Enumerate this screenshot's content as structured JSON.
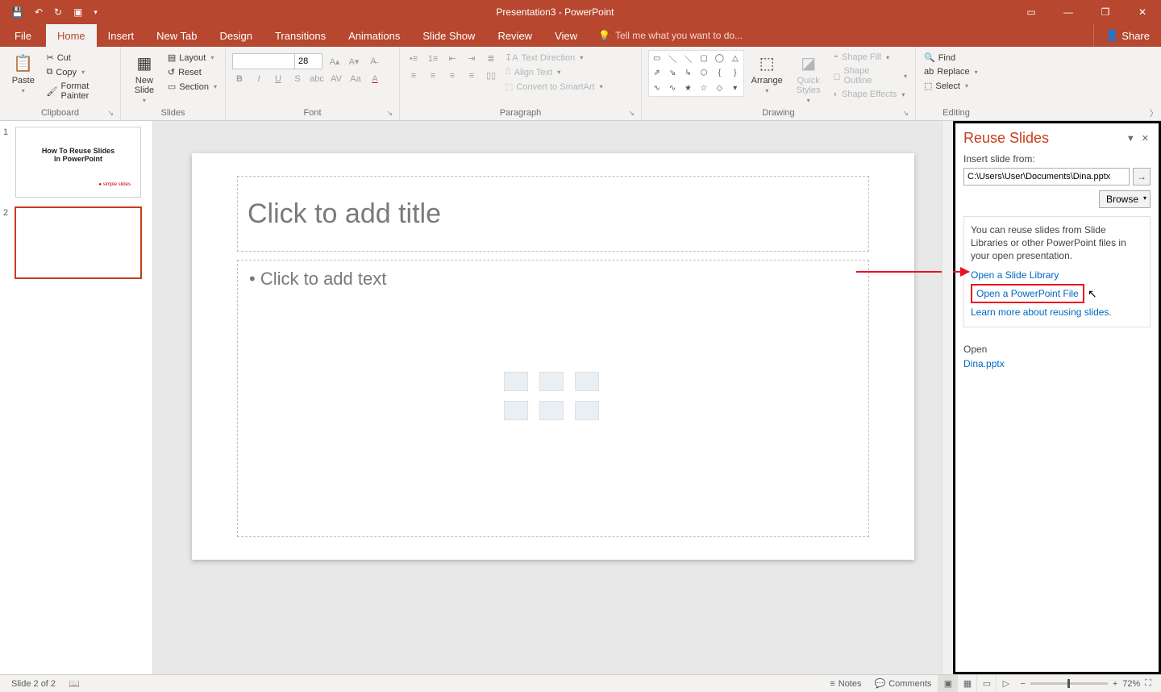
{
  "titlebar": {
    "title": "Presentation3 - PowerPoint"
  },
  "tabs": {
    "file": "File",
    "home": "Home",
    "insert": "Insert",
    "newtab": "New Tab",
    "design": "Design",
    "transitions": "Transitions",
    "animations": "Animations",
    "slideshow": "Slide Show",
    "review": "Review",
    "view": "View",
    "tellme": "Tell me what you want to do...",
    "share": "Share"
  },
  "ribbon": {
    "clipboard": {
      "label": "Clipboard",
      "paste": "Paste",
      "cut": "Cut",
      "copy": "Copy",
      "painter": "Format Painter"
    },
    "slides": {
      "label": "Slides",
      "new": "New\nSlide",
      "layout": "Layout",
      "reset": "Reset",
      "section": "Section"
    },
    "font": {
      "label": "Font",
      "size": "28"
    },
    "paragraph": {
      "label": "Paragraph",
      "textdir": "Text Direction",
      "align": "Align Text",
      "smartart": "Convert to SmartArt"
    },
    "drawing": {
      "label": "Drawing",
      "arrange": "Arrange",
      "quick": "Quick\nStyles",
      "fill": "Shape Fill",
      "outline": "Shape Outline",
      "effects": "Shape Effects"
    },
    "editing": {
      "label": "Editing",
      "find": "Find",
      "replace": "Replace",
      "select": "Select"
    }
  },
  "thumbs": {
    "s1_line1": "How To Reuse Slides",
    "s1_line2": "In PowerPoint",
    "s1_brand": "simple slides"
  },
  "slide": {
    "title_ph": "Click to add title",
    "body_ph": "Click to add text"
  },
  "pane": {
    "title": "Reuse Slides",
    "insert_from": "Insert slide from:",
    "path": "C:\\Users\\User\\Documents\\Dina.pptx",
    "browse": "Browse",
    "info": "You can reuse slides from Slide Libraries or other PowerPoint files in your open presentation.",
    "open_lib": "Open a Slide Library",
    "open_file": "Open a PowerPoint File",
    "learn": "Learn more about reusing slides.",
    "open_h": "Open",
    "recent1": "Dina.pptx"
  },
  "status": {
    "slide": "Slide 2 of 2",
    "notes": "Notes",
    "comments": "Comments",
    "zoom": "72%"
  }
}
